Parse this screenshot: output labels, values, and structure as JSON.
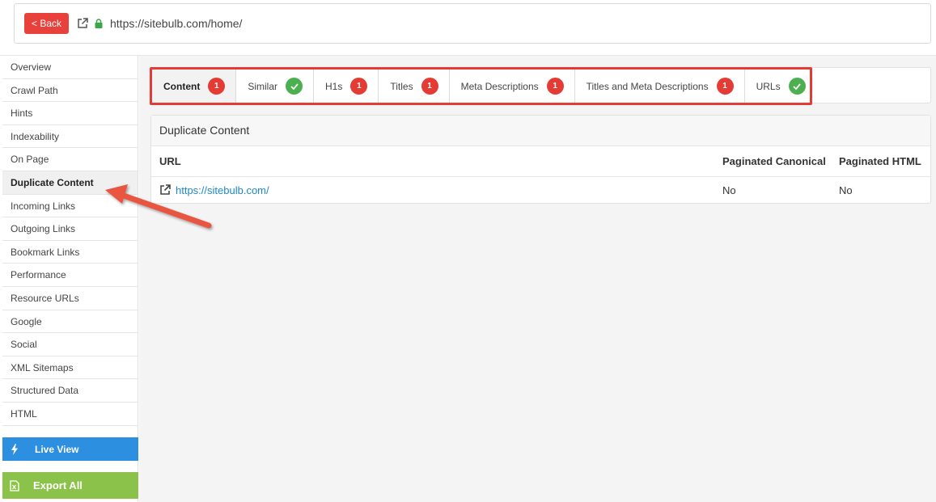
{
  "topbar": {
    "back_label": "< Back",
    "url": "https://sitebulb.com/home/"
  },
  "sidebar": {
    "items": [
      {
        "label": "Overview",
        "active": false
      },
      {
        "label": "Crawl Path",
        "active": false
      },
      {
        "label": "Hints",
        "active": false
      },
      {
        "label": "Indexability",
        "active": false
      },
      {
        "label": "On Page",
        "active": false
      },
      {
        "label": "Duplicate Content",
        "active": true
      },
      {
        "label": "Incoming Links",
        "active": false
      },
      {
        "label": "Outgoing Links",
        "active": false
      },
      {
        "label": "Bookmark Links",
        "active": false
      },
      {
        "label": "Performance",
        "active": false
      },
      {
        "label": "Resource URLs",
        "active": false
      },
      {
        "label": "Google",
        "active": false
      },
      {
        "label": "Social",
        "active": false
      },
      {
        "label": "XML Sitemaps",
        "active": false
      },
      {
        "label": "Structured Data",
        "active": false
      },
      {
        "label": "HTML",
        "active": false
      }
    ],
    "live_view_label": "Live View",
    "export_all_label": "Export All"
  },
  "tabs": [
    {
      "label": "Content",
      "badge": "1",
      "status": "error",
      "active": true
    },
    {
      "label": "Similar",
      "badge": "",
      "status": "ok",
      "active": false
    },
    {
      "label": "H1s",
      "badge": "1",
      "status": "error",
      "active": false
    },
    {
      "label": "Titles",
      "badge": "1",
      "status": "error",
      "active": false
    },
    {
      "label": "Meta Descriptions",
      "badge": "1",
      "status": "error",
      "active": false
    },
    {
      "label": "Titles and Meta Descriptions",
      "badge": "1",
      "status": "error",
      "active": false
    },
    {
      "label": "URLs",
      "badge": "",
      "status": "ok",
      "active": false
    }
  ],
  "table": {
    "title": "Duplicate Content",
    "columns": [
      "URL",
      "Paginated Canonical",
      "Paginated HTML"
    ],
    "rows": [
      {
        "url": "https://sitebulb.com/",
        "paginated_canonical": "No",
        "paginated_html": "No"
      }
    ]
  },
  "colors": {
    "back_button": "#e8403a",
    "error_badge": "#e53b35",
    "ok_badge": "#4caf50",
    "live_view": "#2c8fe0",
    "export_all": "#8bc34a",
    "link": "#1e88c8",
    "annotation": "#e8553f"
  }
}
